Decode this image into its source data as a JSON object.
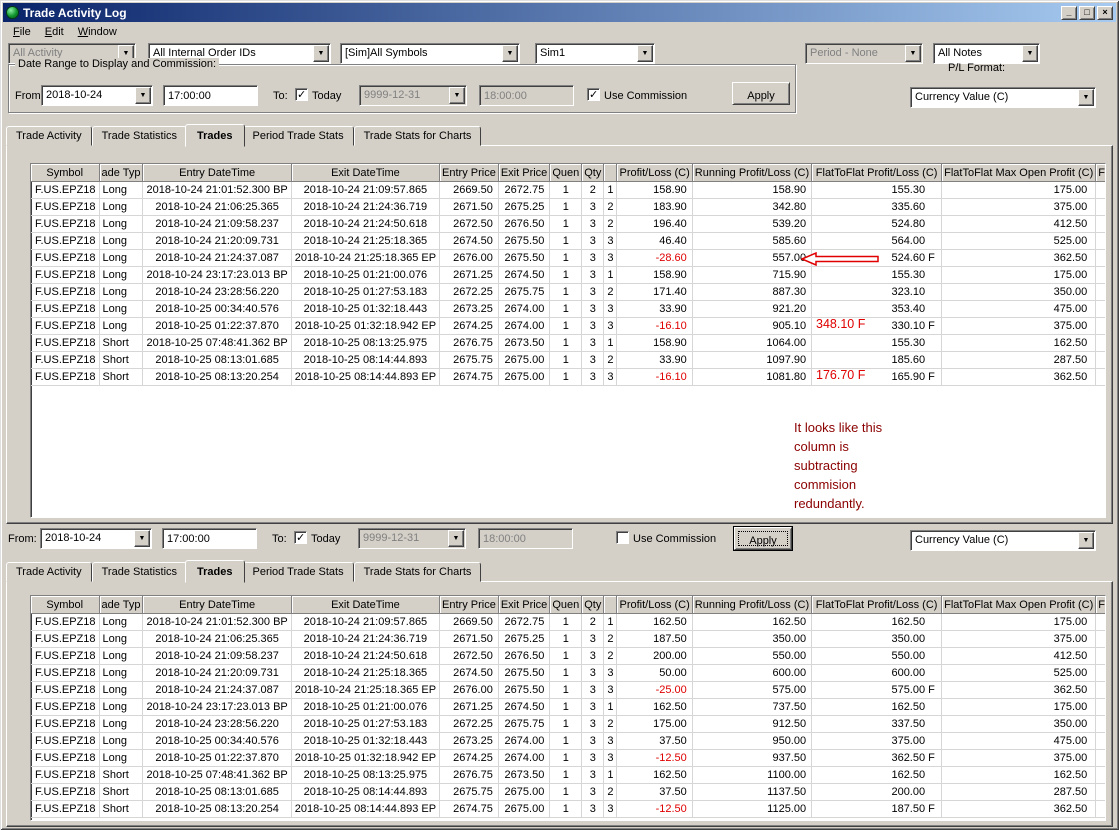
{
  "window": {
    "title": "Trade Activity Log",
    "minimize_glyph": "_",
    "maximize_glyph": "□",
    "close_glyph": "×"
  },
  "menu": {
    "items": [
      "File",
      "Edit",
      "Window"
    ]
  },
  "icons": {
    "chevron_down": "▼"
  },
  "colors": {
    "negative_value": "#e00000",
    "annotation_red": "#e00000",
    "annotation_note": "#8b0000",
    "titlebar_start": "#0a246a",
    "titlebar_end": "#a6caf0"
  },
  "filters": {
    "activity": "All Activity",
    "order_ids": "All Internal Order IDs",
    "symbols": "[Sim]All Symbols",
    "account": "Sim1",
    "period": "Period - None",
    "notes": "All Notes"
  },
  "date_range": {
    "group_label": "Date Range to Display and Commission:",
    "from_label": "From:",
    "from_date": "2018-10-24",
    "from_time": "17:00:00",
    "to_label": "To:",
    "today_label": "Today",
    "today_checked": true,
    "to_date": "9999-12-31",
    "to_time": "18:00:00",
    "use_commission_label": "Use Commission",
    "use_commission_checked": true,
    "apply_label": "Apply"
  },
  "pl_format": {
    "label": "P/L Format:",
    "value": "Currency Value (C)"
  },
  "tabs": {
    "items": [
      "Trade Activity",
      "Trade Statistics",
      "Trades",
      "Period Trade Stats",
      "Trade Stats for Charts"
    ],
    "active": "Trades"
  },
  "table_headers": [
    "Symbol",
    "ade Typ",
    "Entry DateTime",
    "Exit DateTime",
    "Entry Price",
    "Exit Price",
    "Quen",
    "Qty",
    "",
    "Profit/Loss (C)",
    "Running Profit/Loss (C)",
    "FlatToFlat Profit/Loss (C)",
    "FlatToFlat Max Open Profit (C)",
    "Fl"
  ],
  "table1": {
    "rows": [
      [
        "F.US.EPZ18",
        "Long",
        "2018-10-24 21:01:52.300 BP",
        "2018-10-24 21:09:57.865",
        "2669.50",
        "2672.75",
        "1",
        "2",
        "1",
        "158.90",
        "158.90",
        "155.30",
        "175.00",
        ""
      ],
      [
        "F.US.EPZ18",
        "Long",
        "2018-10-24 21:06:25.365",
        "2018-10-24 21:24:36.719",
        "2671.50",
        "2675.25",
        "1",
        "3",
        "2",
        "183.90",
        "342.80",
        "335.60",
        "375.00",
        ""
      ],
      [
        "F.US.EPZ18",
        "Long",
        "2018-10-24 21:09:58.237",
        "2018-10-24 21:24:50.618",
        "2672.50",
        "2676.50",
        "1",
        "3",
        "2",
        "196.40",
        "539.20",
        "524.80",
        "412.50",
        ""
      ],
      [
        "F.US.EPZ18",
        "Long",
        "2018-10-24 21:20:09.731",
        "2018-10-24 21:25:18.365",
        "2674.50",
        "2675.50",
        "1",
        "3",
        "3",
        "46.40",
        "585.60",
        "564.00",
        "525.00",
        ""
      ],
      [
        "F.US.EPZ18",
        "Long",
        "2018-10-24 21:24:37.087",
        "2018-10-24 21:25:18.365 EP",
        "2676.00",
        "2675.50",
        "1",
        "3",
        "3",
        "-28.60",
        "557.00",
        "524.60 F",
        "362.50",
        ""
      ],
      [
        "F.US.EPZ18",
        "Long",
        "2018-10-24 23:17:23.013 BP",
        "2018-10-25 01:21:00.076",
        "2671.25",
        "2674.50",
        "1",
        "3",
        "1",
        "158.90",
        "715.90",
        "155.30",
        "175.00",
        ""
      ],
      [
        "F.US.EPZ18",
        "Long",
        "2018-10-24 23:28:56.220",
        "2018-10-25 01:27:53.183",
        "2672.25",
        "2675.75",
        "1",
        "3",
        "2",
        "171.40",
        "887.30",
        "323.10",
        "350.00",
        ""
      ],
      [
        "F.US.EPZ18",
        "Long",
        "2018-10-25 00:34:40.576",
        "2018-10-25 01:32:18.443",
        "2673.25",
        "2674.00",
        "1",
        "3",
        "3",
        "33.90",
        "921.20",
        "353.40",
        "475.00",
        ""
      ],
      [
        "F.US.EPZ18",
        "Long",
        "2018-10-25 01:22:37.870",
        "2018-10-25 01:32:18.942 EP",
        "2674.25",
        "2674.00",
        "1",
        "3",
        "3",
        "-16.10",
        "905.10",
        "330.10 F",
        "375.00",
        ""
      ],
      [
        "F.US.EPZ18",
        "Short",
        "2018-10-25 07:48:41.362 BP",
        "2018-10-25 08:13:25.975",
        "2676.75",
        "2673.50",
        "1",
        "3",
        "1",
        "158.90",
        "1064.00",
        "155.30",
        "162.50",
        ""
      ],
      [
        "F.US.EPZ18",
        "Short",
        "2018-10-25 08:13:01.685",
        "2018-10-25 08:14:44.893",
        "2675.75",
        "2675.00",
        "1",
        "3",
        "2",
        "33.90",
        "1097.90",
        "185.60",
        "287.50",
        ""
      ],
      [
        "F.US.EPZ18",
        "Short",
        "2018-10-25 08:13:20.254",
        "2018-10-25 08:14:44.893 EP",
        "2674.75",
        "2675.00",
        "1",
        "3",
        "3",
        "-16.10",
        "1081.80",
        "165.90 F",
        "362.50",
        ""
      ]
    ]
  },
  "annotations": {
    "arrow_row_index": 4,
    "red_values": [
      {
        "row_index": 8,
        "text": "348.10 F"
      },
      {
        "row_index": 11,
        "text": "176.70 F"
      }
    ],
    "note_lines": [
      "It looks like this",
      "column is",
      "subtracting",
      "commision",
      "redundantly."
    ]
  },
  "section2": {
    "from_label": "From:",
    "from_date": "2018-10-24",
    "from_time": "17:00:00",
    "to_label": "To:",
    "today_label": "Today",
    "today_checked": true,
    "to_date": "9999-12-31",
    "to_time": "18:00:00",
    "use_commission_label": "Use Commission",
    "use_commission_checked": false,
    "apply_label": "Apply",
    "pl_format_value": "Currency Value (C)"
  },
  "table2": {
    "rows": [
      [
        "F.US.EPZ18",
        "Long",
        "2018-10-24 21:01:52.300 BP",
        "2018-10-24 21:09:57.865",
        "2669.50",
        "2672.75",
        "1",
        "2",
        "1",
        "162.50",
        "162.50",
        "162.50",
        "175.00",
        ""
      ],
      [
        "F.US.EPZ18",
        "Long",
        "2018-10-24 21:06:25.365",
        "2018-10-24 21:24:36.719",
        "2671.50",
        "2675.25",
        "1",
        "3",
        "2",
        "187.50",
        "350.00",
        "350.00",
        "375.00",
        ""
      ],
      [
        "F.US.EPZ18",
        "Long",
        "2018-10-24 21:09:58.237",
        "2018-10-24 21:24:50.618",
        "2672.50",
        "2676.50",
        "1",
        "3",
        "2",
        "200.00",
        "550.00",
        "550.00",
        "412.50",
        ""
      ],
      [
        "F.US.EPZ18",
        "Long",
        "2018-10-24 21:20:09.731",
        "2018-10-24 21:25:18.365",
        "2674.50",
        "2675.50",
        "1",
        "3",
        "3",
        "50.00",
        "600.00",
        "600.00",
        "525.00",
        ""
      ],
      [
        "F.US.EPZ18",
        "Long",
        "2018-10-24 21:24:37.087",
        "2018-10-24 21:25:18.365 EP",
        "2676.00",
        "2675.50",
        "1",
        "3",
        "3",
        "-25.00",
        "575.00",
        "575.00 F",
        "362.50",
        ""
      ],
      [
        "F.US.EPZ18",
        "Long",
        "2018-10-24 23:17:23.013 BP",
        "2018-10-25 01:21:00.076",
        "2671.25",
        "2674.50",
        "1",
        "3",
        "1",
        "162.50",
        "737.50",
        "162.50",
        "175.00",
        ""
      ],
      [
        "F.US.EPZ18",
        "Long",
        "2018-10-24 23:28:56.220",
        "2018-10-25 01:27:53.183",
        "2672.25",
        "2675.75",
        "1",
        "3",
        "2",
        "175.00",
        "912.50",
        "337.50",
        "350.00",
        ""
      ],
      [
        "F.US.EPZ18",
        "Long",
        "2018-10-25 00:34:40.576",
        "2018-10-25 01:32:18.443",
        "2673.25",
        "2674.00",
        "1",
        "3",
        "3",
        "37.50",
        "950.00",
        "375.00",
        "475.00",
        ""
      ],
      [
        "F.US.EPZ18",
        "Long",
        "2018-10-25 01:22:37.870",
        "2018-10-25 01:32:18.942 EP",
        "2674.25",
        "2674.00",
        "1",
        "3",
        "3",
        "-12.50",
        "937.50",
        "362.50 F",
        "375.00",
        ""
      ],
      [
        "F.US.EPZ18",
        "Short",
        "2018-10-25 07:48:41.362 BP",
        "2018-10-25 08:13:25.975",
        "2676.75",
        "2673.50",
        "1",
        "3",
        "1",
        "162.50",
        "1100.00",
        "162.50",
        "162.50",
        ""
      ],
      [
        "F.US.EPZ18",
        "Short",
        "2018-10-25 08:13:01.685",
        "2018-10-25 08:14:44.893",
        "2675.75",
        "2675.00",
        "1",
        "3",
        "2",
        "37.50",
        "1137.50",
        "200.00",
        "287.50",
        ""
      ],
      [
        "F.US.EPZ18",
        "Short",
        "2018-10-25 08:13:20.254",
        "2018-10-25 08:14:44.893 EP",
        "2674.75",
        "2675.00",
        "1",
        "3",
        "3",
        "-12.50",
        "1125.00",
        "187.50 F",
        "362.50",
        ""
      ]
    ]
  }
}
